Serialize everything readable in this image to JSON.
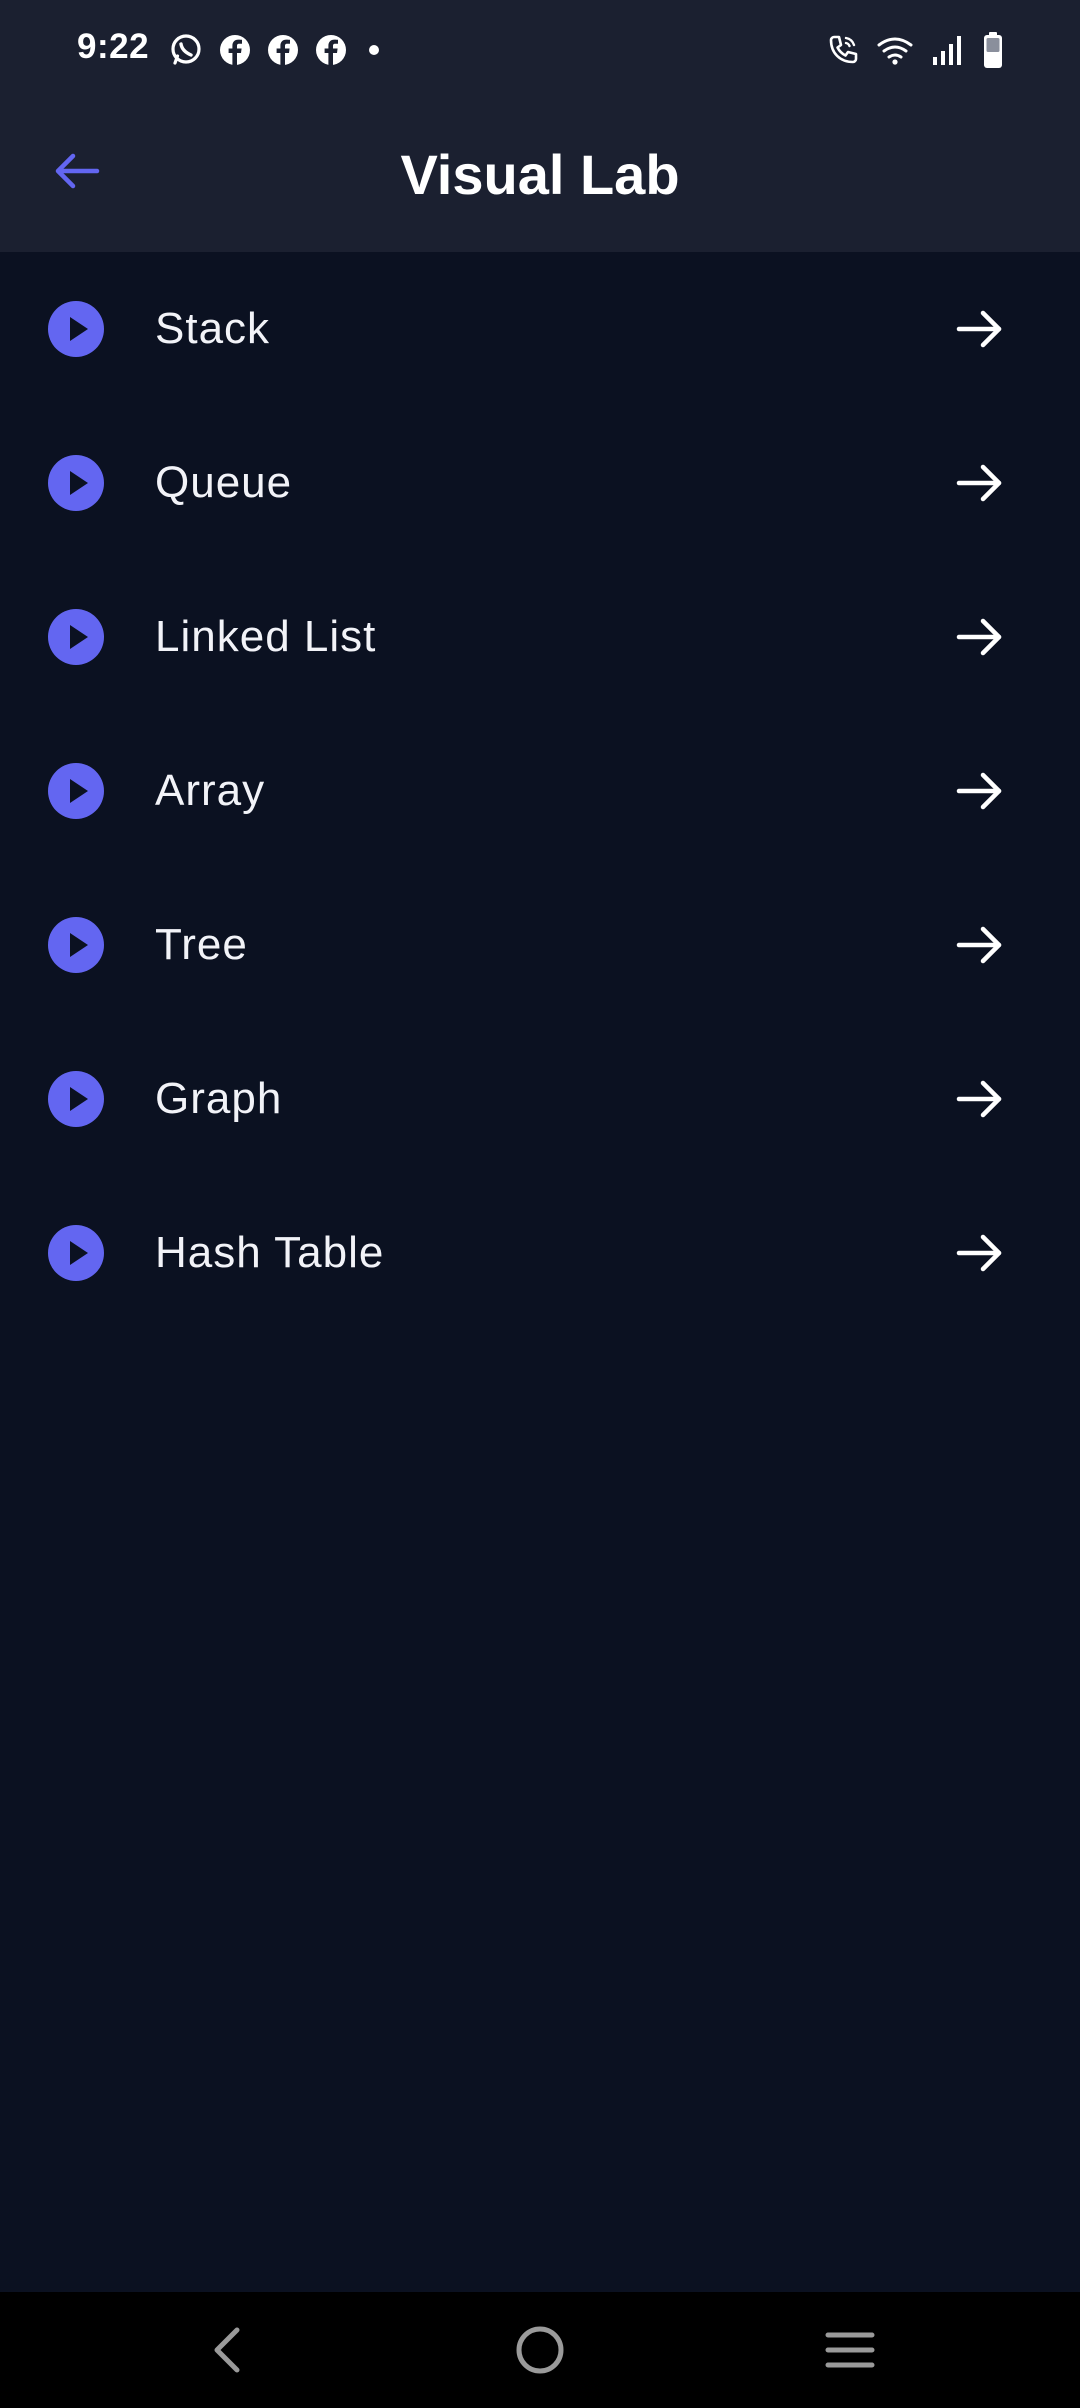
{
  "status_bar": {
    "time": "9:22",
    "notification_icons": [
      "whatsapp-icon",
      "facebook-icon",
      "facebook-icon",
      "facebook-icon",
      "more-dot-icon"
    ],
    "system_icons": [
      "wifi-call-icon",
      "wifi-icon",
      "signal-icon",
      "battery-icon"
    ]
  },
  "app_bar": {
    "title": "Visual Lab",
    "back_icon": "arrow-back-icon"
  },
  "list": {
    "items": [
      {
        "label": "Stack"
      },
      {
        "label": "Queue"
      },
      {
        "label": "Linked List"
      },
      {
        "label": "Array"
      },
      {
        "label": "Tree"
      },
      {
        "label": "Graph"
      },
      {
        "label": "Hash Table"
      }
    ]
  },
  "nav_bar": {
    "buttons": [
      "back-nav-icon",
      "home-nav-icon",
      "recents-nav-icon"
    ]
  },
  "colors": {
    "background": "#0b1121",
    "app_bar": "#1b2030",
    "accent": "#6366f1",
    "text": "#ffffff",
    "nav_bar": "#000000"
  }
}
